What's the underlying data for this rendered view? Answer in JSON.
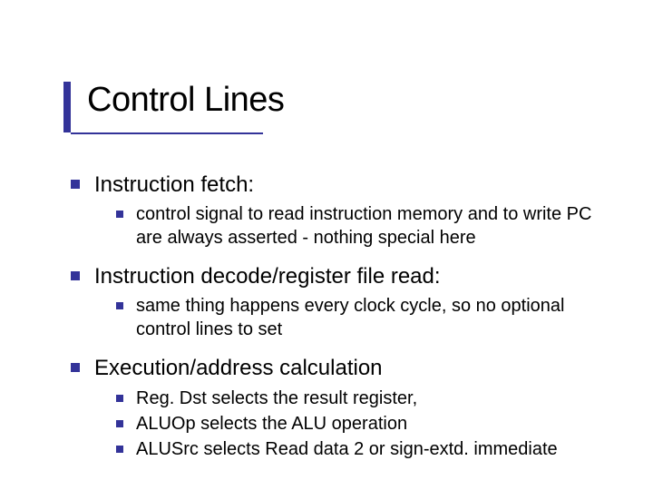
{
  "title": "Control Lines",
  "sections": [
    {
      "heading": "Instruction fetch:",
      "items": [
        "control signal to read instruction memory and to write PC are always asserted - nothing special here"
      ]
    },
    {
      "heading": "Instruction decode/register file read:",
      "items": [
        "same thing happens every clock cycle, so no optional control lines to set"
      ]
    },
    {
      "heading": "Execution/address calculation",
      "items": [
        "Reg. Dst selects the result register,",
        "ALUOp selects the ALU operation",
        "ALUSrc selects Read data 2 or sign-extd. immediate"
      ]
    }
  ]
}
